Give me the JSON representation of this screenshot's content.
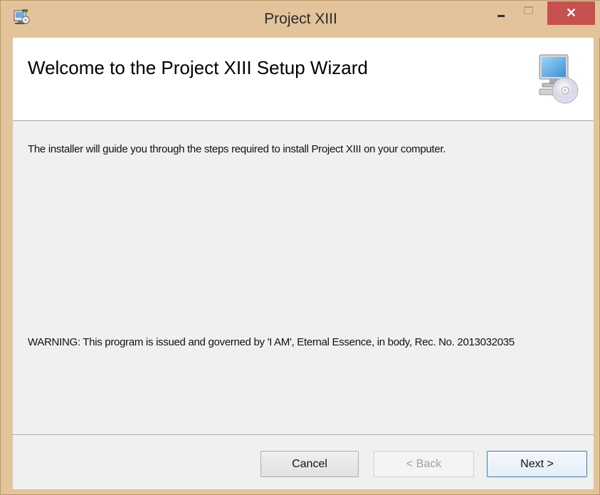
{
  "window": {
    "title": "Project XIII",
    "close_glyph": "✕",
    "icons": {
      "app": "installer-icon",
      "banner": "computer-cd-icon"
    },
    "colors": {
      "titlebar": "#e3c39a",
      "close": "#c75050"
    }
  },
  "banner": {
    "title": "Welcome to the Project XIII Setup Wizard"
  },
  "content": {
    "intro": "The installer will guide you through the steps required to install Project XIII on your computer.",
    "warning": "WARNING: This program is issued and governed by 'I AM', Eternal Essence, in body, Rec. No. 2013032035"
  },
  "buttons": {
    "cancel": "Cancel",
    "back": "< Back",
    "next": "Next >"
  }
}
